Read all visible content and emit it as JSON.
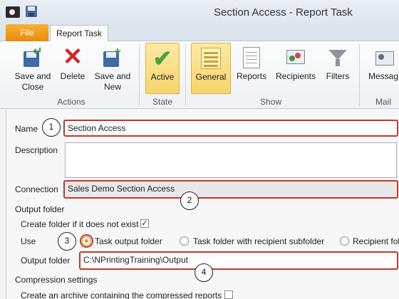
{
  "window": {
    "title": "Section Access - Report Task"
  },
  "tabs": {
    "file": "File",
    "report_task": "Report Task"
  },
  "ribbon": {
    "actions": {
      "label": "Actions",
      "save_close": [
        "Save and",
        "Close"
      ],
      "delete": "Delete",
      "save_new": [
        "Save and",
        "New"
      ]
    },
    "state": {
      "label": "State",
      "active": "Active"
    },
    "show": {
      "label": "Show",
      "general": "General",
      "reports": "Reports",
      "recipients": "Recipients",
      "filters": "Filters"
    },
    "mail": {
      "label": "Mail",
      "message": "Messag"
    }
  },
  "form": {
    "name_label": "Name",
    "name_value": "Section Access",
    "description_label": "Description",
    "description_value": "",
    "connection_label": "Connection",
    "connection_value": "Sales Demo Section Access",
    "output_folder_heading": "Output folder",
    "create_folder_label": "Create folder if it does not exist",
    "create_folder_checked": true,
    "use_label": "Use",
    "use_options": [
      "Task output folder",
      "Task folder with recipient subfolder",
      "Recipient fol"
    ],
    "use_selected": "Task output folder",
    "output_folder_label": "Output  folder",
    "output_folder_value": "C:\\NPrintingTraining\\Output",
    "compression_heading": "Compression settings",
    "archive_label": "Create an archive containing the compressed reports",
    "archive_checked": false
  },
  "callouts": [
    "1",
    "2",
    "3",
    "4"
  ],
  "colors": {
    "highlight": "#c0392b",
    "active_state": "#f8d56b",
    "file_tab": "#e88a0c",
    "check_green": "#49a33c",
    "delete_red": "#d2262a"
  }
}
